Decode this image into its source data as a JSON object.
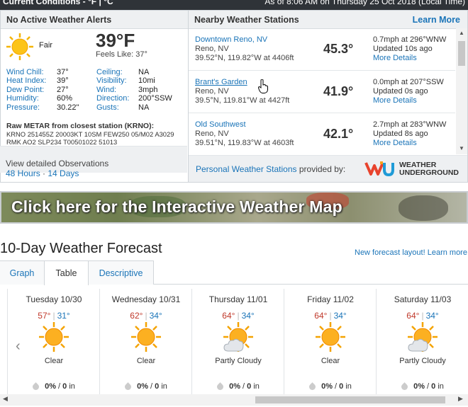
{
  "topbar": {
    "left": "Current Conditions - °F | °C",
    "right": "As of 8:06 AM on Thursday 25 Oct 2018 (Local Time)"
  },
  "alerts": {
    "title": "No Active Weather Alerts"
  },
  "current": {
    "condition": "Fair",
    "temp": "39°F",
    "feels": "Feels Like: 37°",
    "metrics": [
      {
        "k1": "Wind Chill:",
        "v1": "37°",
        "k2": "Ceiling:",
        "v2": "NA"
      },
      {
        "k1": "Heat Index:",
        "v1": "39°",
        "k2": "Visibility:",
        "v2": "10mi"
      },
      {
        "k1": "Dew Point:",
        "v1": "27°",
        "k2": "Wind:",
        "v2": "3mph"
      },
      {
        "k1": "Humidity:",
        "v1": "60%",
        "k2": "Direction:",
        "v2": "200°SSW"
      },
      {
        "k1": "Pressure:",
        "v1": "30.22\"",
        "k2": "Gusts:",
        "v2": "NA"
      }
    ],
    "metar_title": "Raw METAR from closest station (KRNO):",
    "metar_line1": "KRNO 251455Z 20003KT 10SM FEW250 05/M02 A3029",
    "metar_line2": "RMK AO2 SLP234 T00501022 51013",
    "view_detail": "View detailed Observations",
    "link_48": "48 Hours",
    "dot": " · ",
    "link_14": "14 Days"
  },
  "stations": {
    "title": "Nearby Weather Stations",
    "learn_more": "Learn More",
    "items": [
      {
        "name": "Downtown Reno, NV",
        "city": "Reno, NV",
        "loc": "39.52°N, 119.82°W at 4406ft",
        "temp": "45.3°",
        "wind": "0.7mph at 296°WNW",
        "updated": "Updated 10s ago",
        "more": "More Details"
      },
      {
        "name": "Brant's Garden",
        "city": "Reno, NV",
        "loc": "39.5°N, 119.81°W at 4427ft",
        "temp": "41.9°",
        "wind": "0.0mph at 207°SSW",
        "updated": "Updated 0s ago",
        "more": "More Details"
      },
      {
        "name": "Old Southwest",
        "city": "Reno, NV",
        "loc": "39.51°N, 119.83°W at 4603ft",
        "temp": "42.1°",
        "wind": "2.7mph at 283°WNW",
        "updated": "Updated 8s ago",
        "more": "More Details"
      }
    ],
    "pws_link": "Personal Weather Stations",
    "provided_by": " provided by:",
    "wu_line1": "WEATHER",
    "wu_line2": "UNDERGROUND"
  },
  "banner": {
    "text": "Click here for the  Interactive Weather Map"
  },
  "forecast": {
    "title": "10-Day Weather Forecast",
    "new_layout": "New forecast layout! Learn more",
    "tabs": [
      "Graph",
      "Table",
      "Descriptive"
    ],
    "prev": "‹",
    "days": [
      {
        "name": "Tuesday 10/30",
        "hi": "57°",
        "lo": "31°",
        "cond": "Clear",
        "icon": "sun-icon",
        "precip": "0%",
        "amount": "0",
        "unit": " in"
      },
      {
        "name": "Wednesday 10/31",
        "hi": "62°",
        "lo": "34°",
        "cond": "Clear",
        "icon": "sun-icon",
        "precip": "0%",
        "amount": "0",
        "unit": " in"
      },
      {
        "name": "Thursday 11/01",
        "hi": "64°",
        "lo": "34°",
        "cond": "Partly Cloudy",
        "icon": "partly-cloudy-icon",
        "precip": "0%",
        "amount": "0",
        "unit": " in"
      },
      {
        "name": "Friday 11/02",
        "hi": "64°",
        "lo": "34°",
        "cond": "Clear",
        "icon": "sun-icon",
        "precip": "0%",
        "amount": "0",
        "unit": " in"
      },
      {
        "name": "Saturday 11/03",
        "hi": "64°",
        "lo": "34°",
        "cond": "Partly Cloudy",
        "icon": "partly-cloudy-icon",
        "precip": "0%",
        "amount": "0",
        "unit": " in"
      }
    ],
    "slash": " / ",
    "sep": "|"
  },
  "colors": {
    "link": "#1a74b8",
    "high": "#c0392b",
    "low": "#1a74b8",
    "topbar": "#2f3338"
  }
}
